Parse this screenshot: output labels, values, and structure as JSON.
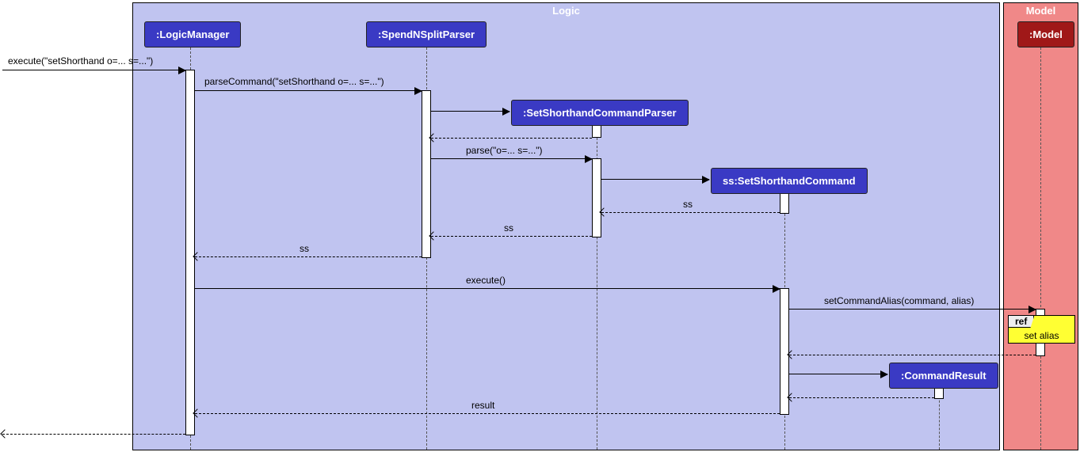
{
  "frames": {
    "logic": {
      "title": "Logic",
      "bg": "#c0c4f0",
      "titleColor": "#ffffff"
    },
    "model": {
      "title": "Model",
      "bg": "#f08888",
      "titleColor": "#ffffff"
    }
  },
  "participants": {
    "logicManager": ":LogicManager",
    "spendParser": ":SpendNSplitParser",
    "setShorthandParser": ":SetShorthandCommandParser",
    "setShorthandCmd": "ss:SetShorthandCommand",
    "commandResult": ":CommandResult",
    "model": ":Model"
  },
  "messages": {
    "execute1": "execute(\"setShorthand o=... s=...\")",
    "parseCommand": "parseCommand(\"setShorthand o=... s=...\")",
    "parse": "parse(\"o=... s=...\")",
    "ss1": "ss",
    "ss2": "ss",
    "ss3": "ss",
    "execute2": "execute()",
    "setAlias": "setCommandAlias(command, alias)",
    "result": "result"
  },
  "ref": {
    "label": "ref",
    "text": "set alias"
  },
  "colors": {
    "participantBg": "#3a3ac4",
    "modelHeadBg": "#a01818"
  }
}
